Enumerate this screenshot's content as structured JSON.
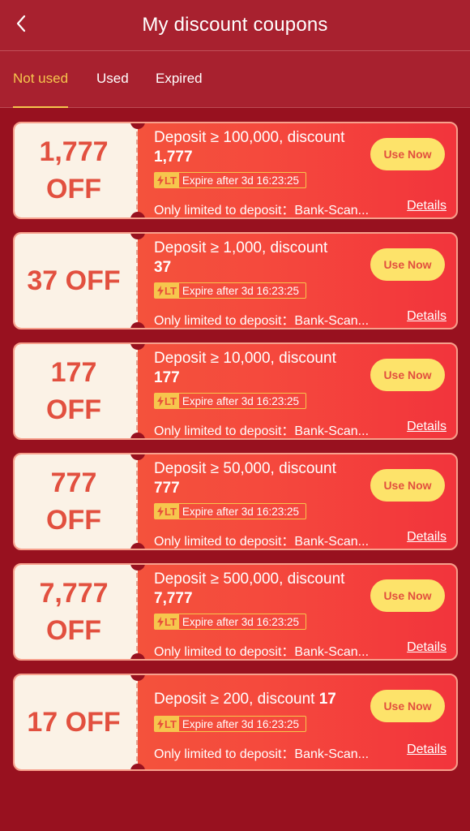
{
  "header": {
    "title": "My discount coupons"
  },
  "tabs": [
    {
      "label": "Not used",
      "active": true
    },
    {
      "label": "Used",
      "active": false
    },
    {
      "label": "Expired",
      "active": false
    }
  ],
  "colors": {
    "background": "#98111f",
    "accent": "#f6c64d",
    "button": "#fde36a",
    "amount": "#e2503f"
  },
  "coupons": [
    {
      "amount_line1": "1,777",
      "amount_line2": "OFF",
      "desc": "Deposit ≥ 100,000, discount",
      "desc_value": "1,777",
      "lt": "LT",
      "expire": "Expire after 3d 16:23:25",
      "limit": "Only limited to deposit：Bank-Scan...",
      "details": "Details",
      "button": "Use Now"
    },
    {
      "amount_line1": "37 OFF",
      "amount_line2": "",
      "desc": "Deposit ≥ 1,000, discount",
      "desc_value": "37",
      "lt": "LT",
      "expire": "Expire after 3d 16:23:25",
      "limit": "Only limited to deposit：Bank-Scan...",
      "details": "Details",
      "button": "Use Now"
    },
    {
      "amount_line1": "177",
      "amount_line2": "OFF",
      "desc": "Deposit ≥ 10,000, discount",
      "desc_value": "177",
      "lt": "LT",
      "expire": "Expire after 3d 16:23:25",
      "limit": "Only limited to deposit：Bank-Scan...",
      "details": "Details",
      "button": "Use Now"
    },
    {
      "amount_line1": "777",
      "amount_line2": "OFF",
      "desc": "Deposit ≥ 50,000, discount",
      "desc_value": "777",
      "lt": "LT",
      "expire": "Expire after 3d 16:23:25",
      "limit": "Only limited to deposit：Bank-Scan...",
      "details": "Details",
      "button": "Use Now"
    },
    {
      "amount_line1": "7,777",
      "amount_line2": "OFF",
      "desc": "Deposit ≥ 500,000, discount",
      "desc_value": "7,777",
      "lt": "LT",
      "expire": "Expire after 3d 16:23:25",
      "limit": "Only limited to deposit：Bank-Scan...",
      "details": "Details",
      "button": "Use Now"
    },
    {
      "amount_line1": "17 OFF",
      "amount_line2": "",
      "desc": "Deposit ≥ 200, discount",
      "desc_value": "17",
      "lt": "LT",
      "expire": "Expire after 3d 16:23:25",
      "limit": "Only limited to deposit：Bank-Scan...",
      "details": "Details",
      "button": "Use Now"
    }
  ]
}
